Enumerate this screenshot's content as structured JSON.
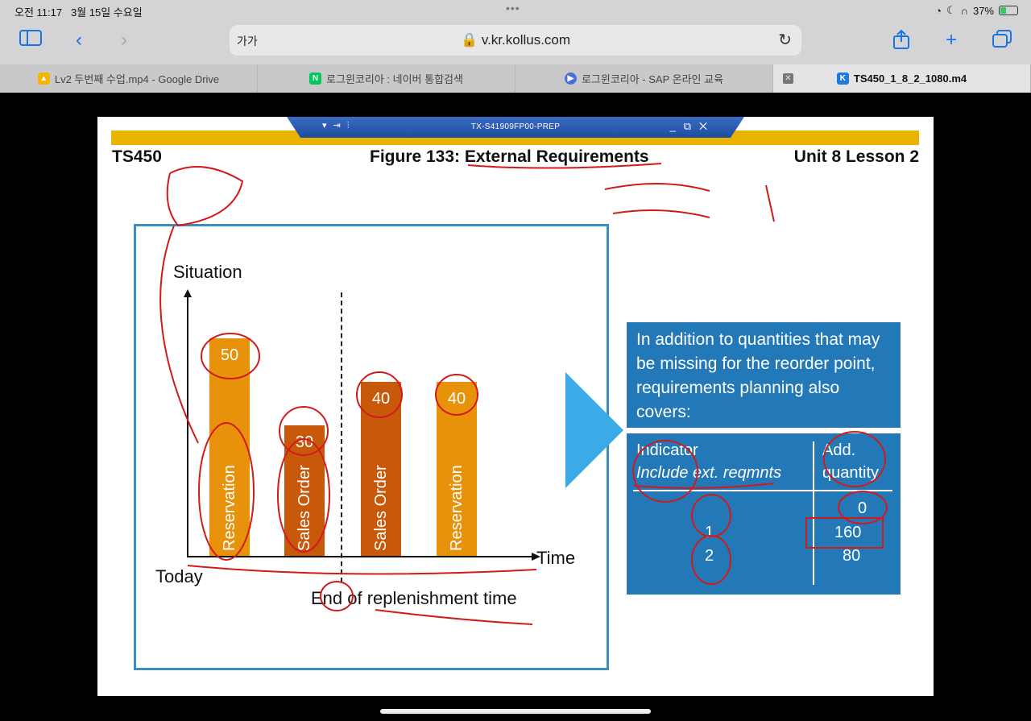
{
  "status_bar": {
    "time": "오전 11:17",
    "date": "3월 15일 수요일",
    "battery": "37%",
    "battery_level": 0.37
  },
  "toolbar": {
    "text_size": "가가",
    "url": "v.kr.kollus.com"
  },
  "tabs": [
    {
      "label": "Lv2 두번째 수업.mp4 - Google Drive",
      "favicon": "google-drive-icon",
      "color": "#2b8a3e"
    },
    {
      "label": "로그윈코리아 : 네이버 통합검색",
      "favicon": "naver-icon",
      "color": "#03c75a"
    },
    {
      "label": "로그윈코리아 - SAP 온라인 교육",
      "favicon": "play-icon",
      "color": "#4a6fd8"
    },
    {
      "label": "TS450_1_8_2_1080.m4",
      "favicon": "kollus-icon",
      "color": "#1f7ae0",
      "active": true
    }
  ],
  "window": {
    "title": "TX-S41909FP00-PREP"
  },
  "slide": {
    "course": "TS450",
    "figure_title": "Figure 133: External Requirements",
    "unit": "Unit 8 Lesson 2",
    "y_label": "Situation",
    "x_label": "Time",
    "today_label": "Today",
    "end_label": "End of replenishment time",
    "info_text": "In  addition to quantities that may be missing for the reorder point, requirements planning also covers:",
    "table": {
      "col1_header_1": "Indicator",
      "col1_header_2": "Include ext. reqmnts",
      "col2_header_1": "Add.",
      "col2_header_2": "quantity",
      "rows": [
        {
          "indicator": "",
          "qty": "0"
        },
        {
          "indicator": "1",
          "qty": "160"
        },
        {
          "indicator": "2",
          "qty": "80"
        }
      ]
    }
  },
  "chart_data": {
    "type": "bar",
    "categories": [
      "Reservation",
      "Sales Order",
      "Sales Order",
      "Reservation"
    ],
    "values": [
      50,
      30,
      40,
      40
    ],
    "colors": [
      "#e8920c",
      "#c8580a",
      "#c8580a",
      "#e8920c"
    ],
    "title": "",
    "ylabel": "Situation",
    "xlabel": "Time"
  }
}
